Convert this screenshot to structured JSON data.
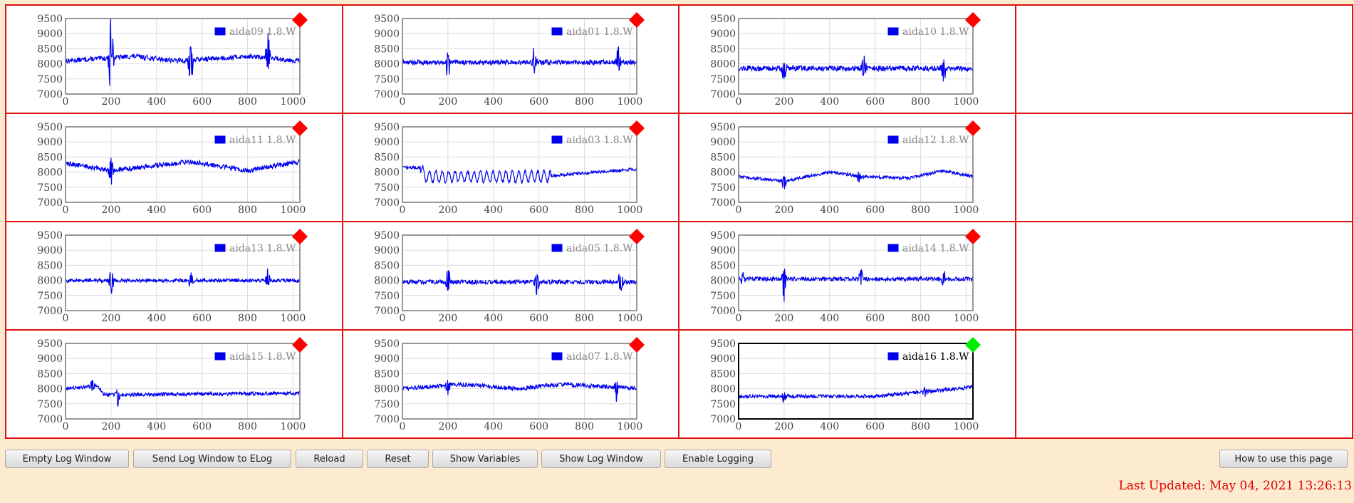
{
  "colors": {
    "border": "#dd1111",
    "page_background": "#fdebd0",
    "series": "#0000ee",
    "status_alarm": "#ff0000",
    "status_ok": "#00ee00"
  },
  "status_icon": "diamond-icon",
  "chart_data": [
    {
      "type": "line",
      "series": [
        {
          "name": "aida09 1.8.W"
        }
      ],
      "x": [
        0,
        1000
      ],
      "y_ticks": [
        7000,
        7500,
        8000,
        8500,
        9000,
        9500
      ],
      "x_ticks": [
        0,
        200,
        400,
        600,
        800,
        1000
      ],
      "ylim": [
        7000,
        9500
      ],
      "xlim": [
        0,
        1030
      ],
      "grid": true,
      "legend": "top-right",
      "status": "alarm",
      "baseline": 8100,
      "noise": 80,
      "drift": [
        [
          0,
          0
        ],
        [
          300,
          150
        ],
        [
          500,
          0
        ],
        [
          800,
          150
        ],
        [
          1030,
          0
        ]
      ],
      "spikes": [
        [
          200,
          700
        ],
        [
          200,
          -1100
        ],
        [
          550,
          -800
        ],
        [
          890,
          700
        ]
      ]
    },
    {
      "type": "line",
      "series": [
        {
          "name": "aida01 1.8.W"
        }
      ],
      "x": [
        0,
        1000
      ],
      "y_ticks": [
        7000,
        7500,
        8000,
        8500,
        9000,
        9500
      ],
      "x_ticks": [
        0,
        200,
        400,
        600,
        800,
        1000
      ],
      "ylim": [
        7000,
        9500
      ],
      "xlim": [
        0,
        1030
      ],
      "grid": true,
      "legend": "top-right",
      "status": "alarm",
      "baseline": 8050,
      "noise": 80,
      "drift": [
        [
          0,
          0
        ],
        [
          1030,
          0
        ]
      ],
      "spikes": [
        [
          200,
          -550
        ],
        [
          580,
          500
        ],
        [
          950,
          450
        ]
      ]
    },
    {
      "type": "line",
      "series": [
        {
          "name": "aida10 1.8.W"
        }
      ],
      "x": [
        0,
        1000
      ],
      "y_ticks": [
        7000,
        7500,
        8000,
        8500,
        9000,
        9500
      ],
      "x_ticks": [
        0,
        200,
        400,
        600,
        800,
        1000
      ],
      "ylim": [
        7000,
        9500
      ],
      "xlim": [
        0,
        1030
      ],
      "grid": true,
      "legend": "top-right",
      "status": "alarm",
      "baseline": 7850,
      "noise": 90,
      "drift": [
        [
          0,
          0
        ],
        [
          1030,
          0
        ]
      ],
      "spikes": [
        [
          200,
          -450
        ],
        [
          550,
          450
        ],
        [
          900,
          -500
        ]
      ]
    },
    {
      "type": "line",
      "series": [
        {
          "name": ""
        }
      ],
      "empty": true
    },
    {
      "type": "line",
      "series": [
        {
          "name": "aida11 1.8.W"
        }
      ],
      "x": [
        0,
        1000
      ],
      "y_ticks": [
        7000,
        7500,
        8000,
        8500,
        9000,
        9500
      ],
      "x_ticks": [
        0,
        200,
        400,
        600,
        800,
        1000
      ],
      "ylim": [
        7000,
        9500
      ],
      "xlim": [
        0,
        1030
      ],
      "grid": true,
      "legend": "top-right",
      "status": "alarm",
      "baseline": 8200,
      "noise": 80,
      "drift": [
        [
          0,
          100
        ],
        [
          200,
          -150
        ],
        [
          550,
          150
        ],
        [
          800,
          -150
        ],
        [
          1030,
          150
        ]
      ],
      "spikes": [
        [
          200,
          -550
        ]
      ]
    },
    {
      "type": "line",
      "series": [
        {
          "name": "aida03 1.8.W"
        }
      ],
      "x": [
        0,
        1000
      ],
      "y_ticks": [
        7000,
        7500,
        8000,
        8500,
        9000,
        9500
      ],
      "x_ticks": [
        0,
        200,
        400,
        600,
        800,
        1000
      ],
      "ylim": [
        7000,
        9500
      ],
      "xlim": [
        0,
        1030
      ],
      "grid": true,
      "legend": "top-right",
      "status": "alarm",
      "baseline": 8000,
      "noise": 50,
      "drift": [
        [
          0,
          150
        ],
        [
          80,
          150
        ],
        [
          100,
          -150
        ],
        [
          600,
          -150
        ],
        [
          1030,
          100
        ]
      ],
      "wave": {
        "amp": 180,
        "period": 28,
        "from": 80,
        "to": 650
      }
    },
    {
      "type": "line",
      "series": [
        {
          "name": "aida12 1.8.W"
        }
      ],
      "x": [
        0,
        1000
      ],
      "y_ticks": [
        7000,
        7500,
        8000,
        8500,
        9000,
        9500
      ],
      "x_ticks": [
        0,
        200,
        400,
        600,
        800,
        1000
      ],
      "ylim": [
        7000,
        9500
      ],
      "xlim": [
        0,
        1030
      ],
      "grid": true,
      "legend": "top-right",
      "status": "alarm",
      "baseline": 7850,
      "noise": 50,
      "drift": [
        [
          0,
          0
        ],
        [
          200,
          -150
        ],
        [
          400,
          150
        ],
        [
          550,
          0
        ],
        [
          750,
          -50
        ],
        [
          900,
          200
        ],
        [
          1030,
          0
        ]
      ],
      "spikes": [
        [
          200,
          -300
        ],
        [
          530,
          -250
        ]
      ]
    },
    {
      "type": "line",
      "series": [
        {
          "name": ""
        }
      ],
      "empty": true
    },
    {
      "type": "line",
      "series": [
        {
          "name": "aida13 1.8.W"
        }
      ],
      "x": [
        0,
        1000
      ],
      "y_ticks": [
        7000,
        7500,
        8000,
        8500,
        9000,
        9500
      ],
      "x_ticks": [
        0,
        200,
        400,
        600,
        800,
        1000
      ],
      "ylim": [
        7000,
        9500
      ],
      "xlim": [
        0,
        1030
      ],
      "grid": true,
      "legend": "top-right",
      "status": "alarm",
      "baseline": 8000,
      "noise": 60,
      "drift": [
        [
          0,
          0
        ],
        [
          1030,
          0
        ]
      ],
      "spikes": [
        [
          200,
          -450
        ],
        [
          550,
          350
        ],
        [
          890,
          400
        ]
      ]
    },
    {
      "type": "line",
      "series": [
        {
          "name": "aida05 1.8.W"
        }
      ],
      "x": [
        0,
        1000
      ],
      "y_ticks": [
        7000,
        7500,
        8000,
        8500,
        9000,
        9500
      ],
      "x_ticks": [
        0,
        200,
        400,
        600,
        800,
        1000
      ],
      "ylim": [
        7000,
        9500
      ],
      "xlim": [
        0,
        1030
      ],
      "grid": true,
      "legend": "top-right",
      "status": "alarm",
      "baseline": 7950,
      "noise": 70,
      "drift": [
        [
          0,
          0
        ],
        [
          1030,
          0
        ]
      ],
      "spikes": [
        [
          200,
          500
        ],
        [
          590,
          -450
        ],
        [
          960,
          450
        ]
      ]
    },
    {
      "type": "line",
      "series": [
        {
          "name": "aida14 1.8.W"
        }
      ],
      "x": [
        0,
        1000
      ],
      "y_ticks": [
        7000,
        7500,
        8000,
        8500,
        9000,
        9500
      ],
      "x_ticks": [
        0,
        200,
        400,
        600,
        800,
        1000
      ],
      "ylim": [
        7000,
        9500
      ],
      "xlim": [
        0,
        1030
      ],
      "grid": true,
      "legend": "top-right",
      "status": "alarm",
      "baseline": 8050,
      "noise": 70,
      "drift": [
        [
          0,
          0
        ],
        [
          1030,
          0
        ]
      ],
      "spikes": [
        [
          20,
          -250
        ],
        [
          200,
          -550
        ],
        [
          540,
          300
        ],
        [
          900,
          300
        ]
      ]
    },
    {
      "type": "line",
      "series": [
        {
          "name": ""
        }
      ],
      "empty": true
    },
    {
      "type": "line",
      "series": [
        {
          "name": "aida15 1.8.W"
        }
      ],
      "x": [
        0,
        1000
      ],
      "y_ticks": [
        7000,
        7500,
        8000,
        8500,
        9000,
        9500
      ],
      "x_ticks": [
        0,
        200,
        400,
        600,
        800,
        1000
      ],
      "ylim": [
        7000,
        9500
      ],
      "xlim": [
        0,
        1030
      ],
      "grid": true,
      "legend": "top-right",
      "status": "alarm",
      "baseline": 7800,
      "noise": 60,
      "drift": [
        [
          0,
          200
        ],
        [
          140,
          300
        ],
        [
          170,
          0
        ],
        [
          1030,
          50
        ]
      ],
      "spikes": [
        [
          230,
          -350
        ],
        [
          120,
          250
        ]
      ]
    },
    {
      "type": "line",
      "series": [
        {
          "name": "aida07 1.8.W"
        }
      ],
      "x": [
        0,
        1000
      ],
      "y_ticks": [
        7000,
        7500,
        8000,
        8500,
        9000,
        9500
      ],
      "x_ticks": [
        0,
        200,
        400,
        600,
        800,
        1000
      ],
      "ylim": [
        7000,
        9500
      ],
      "xlim": [
        0,
        1030
      ],
      "grid": true,
      "legend": "top-right",
      "status": "alarm",
      "baseline": 8000,
      "noise": 70,
      "drift": [
        [
          0,
          0
        ],
        [
          250,
          150
        ],
        [
          500,
          0
        ],
        [
          700,
          150
        ],
        [
          1030,
          0
        ]
      ],
      "spikes": [
        [
          200,
          -300
        ],
        [
          940,
          -350
        ]
      ]
    },
    {
      "type": "line",
      "series": [
        {
          "name": "aida16 1.8.W"
        }
      ],
      "x": [
        0,
        1000
      ],
      "y_ticks": [
        7000,
        7500,
        8000,
        8500,
        9000,
        9500
      ],
      "x_ticks": [
        0,
        200,
        400,
        600,
        800,
        1000
      ],
      "ylim": [
        7000,
        9500
      ],
      "xlim": [
        0,
        1030
      ],
      "grid": true,
      "legend": "top-right",
      "status": "ok",
      "selected": true,
      "baseline": 7750,
      "noise": 60,
      "drift": [
        [
          0,
          0
        ],
        [
          600,
          0
        ],
        [
          1030,
          300
        ]
      ],
      "spikes": [
        [
          200,
          -250
        ],
        [
          820,
          -200
        ]
      ]
    },
    {
      "type": "line",
      "series": [
        {
          "name": ""
        }
      ],
      "empty": true
    }
  ],
  "buttons": [
    {
      "label": "Empty Log Window"
    },
    {
      "label": "Send Log Window to ELog"
    },
    {
      "label": "Reload"
    },
    {
      "label": "Reset"
    },
    {
      "label": "Show Variables"
    },
    {
      "label": "Show Log Window"
    },
    {
      "label": "Enable Logging"
    }
  ],
  "help_button": {
    "label": "How to use this page"
  },
  "last_updated": "Last Updated: May 04, 2021 13:26:13"
}
